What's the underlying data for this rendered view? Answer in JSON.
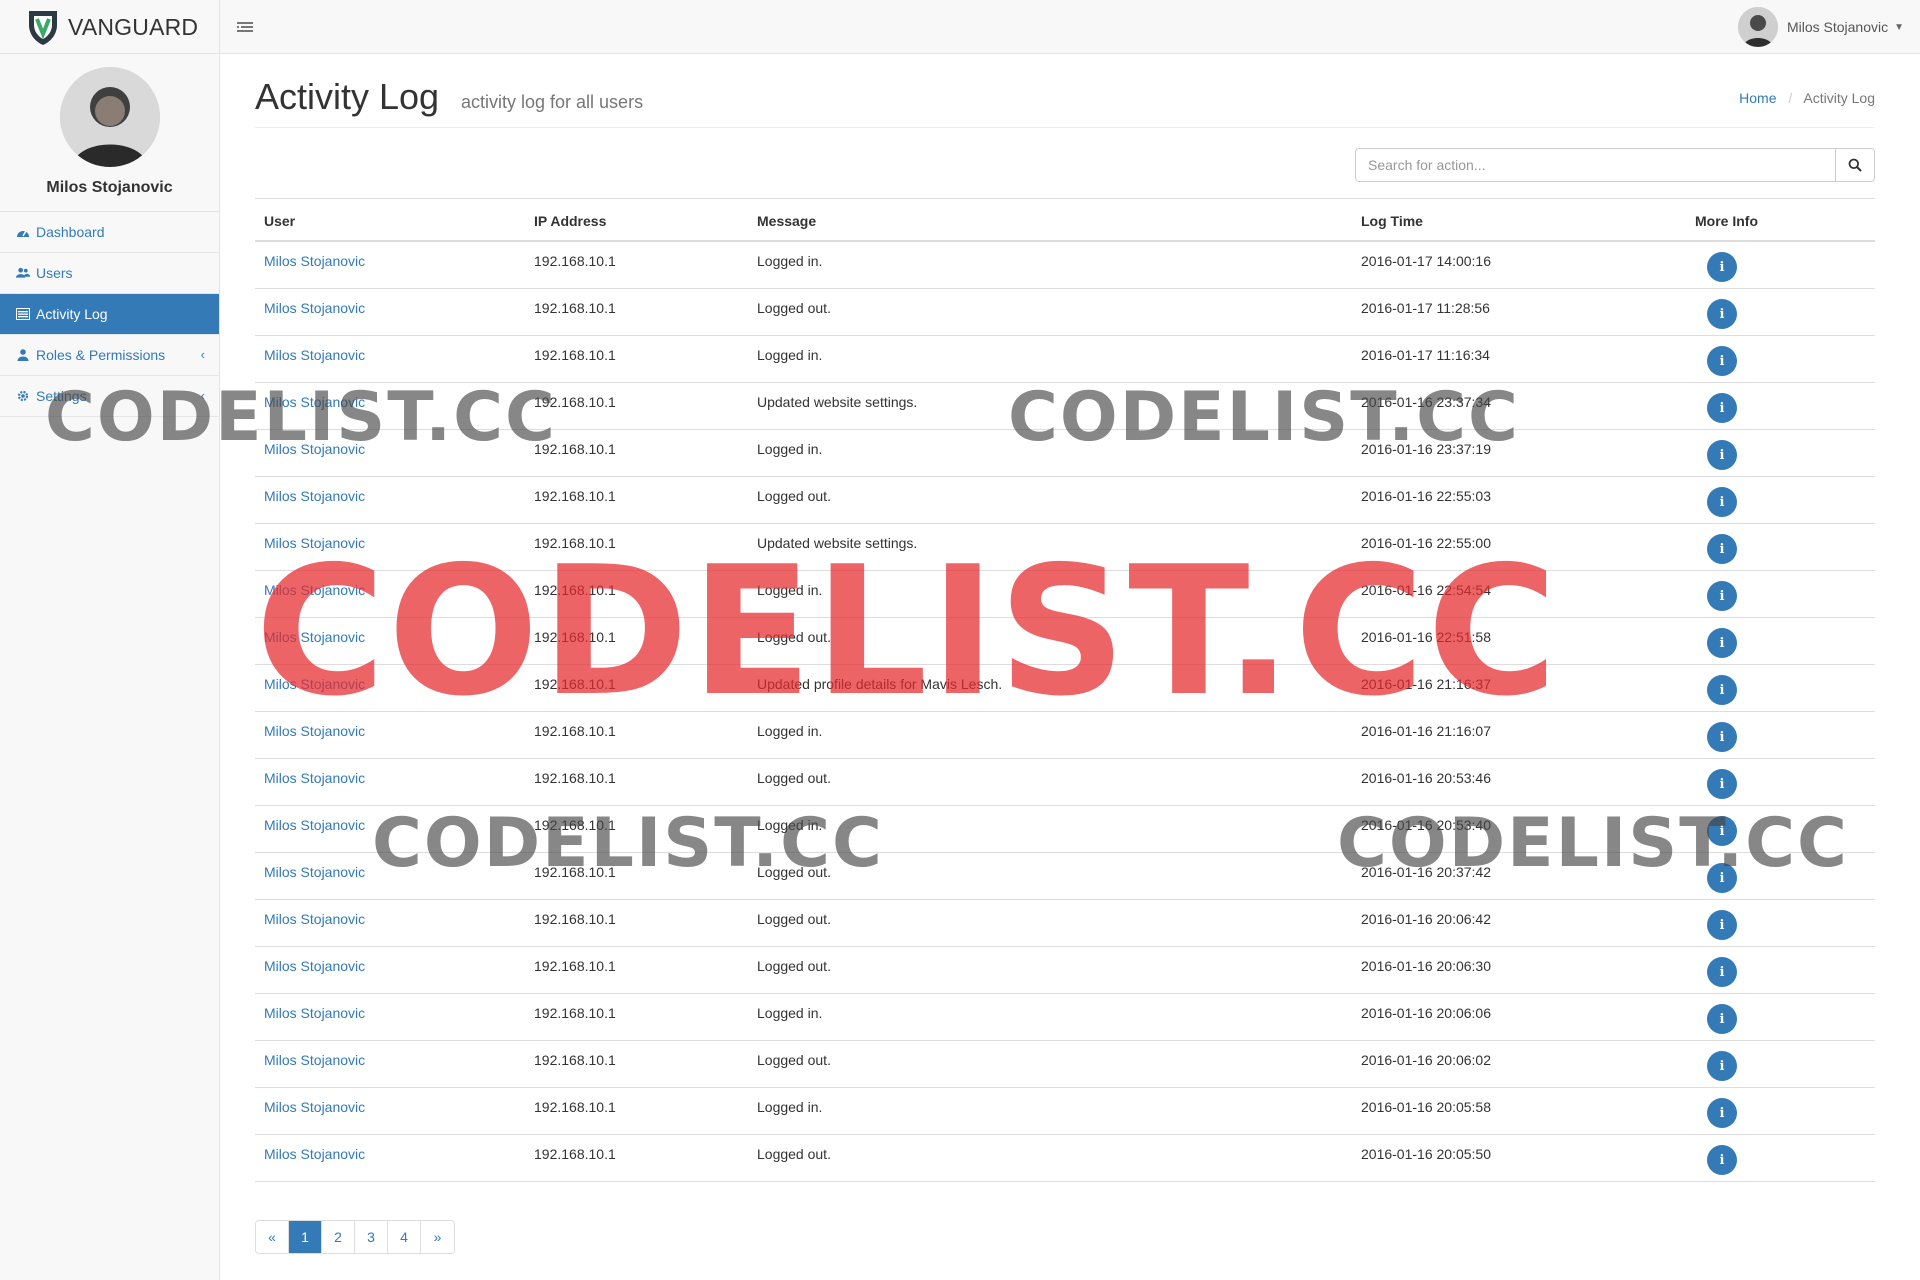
{
  "brand": {
    "name": "VANGUARD"
  },
  "topbar": {
    "user_name": "Milos Stojanovic"
  },
  "sidebar": {
    "profile_name": "Milos Stojanovic",
    "items": [
      {
        "label": "Dashboard",
        "icon": "dashboard-icon",
        "active": false
      },
      {
        "label": "Users",
        "icon": "users-icon",
        "active": false
      },
      {
        "label": "Activity Log",
        "icon": "list-icon",
        "active": true
      },
      {
        "label": "Roles & Permissions",
        "icon": "user-icon",
        "active": false,
        "expandable": true
      },
      {
        "label": "Settings",
        "icon": "gear-icon",
        "active": false,
        "expandable": true
      }
    ]
  },
  "page": {
    "title": "Activity Log",
    "subtitle": "activity log for all users",
    "breadcrumb": {
      "home": "Home",
      "current": "Activity Log"
    }
  },
  "search": {
    "placeholder": "Search for action..."
  },
  "table": {
    "columns": [
      "User",
      "IP Address",
      "Message",
      "Log Time",
      "More Info"
    ],
    "rows": [
      {
        "user": "Milos Stojanovic",
        "ip": "192.168.10.1",
        "message": "Logged in.",
        "time": "2016-01-17 14:00:16"
      },
      {
        "user": "Milos Stojanovic",
        "ip": "192.168.10.1",
        "message": "Logged out.",
        "time": "2016-01-17 11:28:56"
      },
      {
        "user": "Milos Stojanovic",
        "ip": "192.168.10.1",
        "message": "Logged in.",
        "time": "2016-01-17 11:16:34"
      },
      {
        "user": "Milos Stojanovic",
        "ip": "192.168.10.1",
        "message": "Updated website settings.",
        "time": "2016-01-16 23:37:34"
      },
      {
        "user": "Milos Stojanovic",
        "ip": "192.168.10.1",
        "message": "Logged in.",
        "time": "2016-01-16 23:37:19"
      },
      {
        "user": "Milos Stojanovic",
        "ip": "192.168.10.1",
        "message": "Logged out.",
        "time": "2016-01-16 22:55:03"
      },
      {
        "user": "Milos Stojanovic",
        "ip": "192.168.10.1",
        "message": "Updated website settings.",
        "time": "2016-01-16 22:55:00"
      },
      {
        "user": "Milos Stojanovic",
        "ip": "192.168.10.1",
        "message": "Logged in.",
        "time": "2016-01-16 22:54:54"
      },
      {
        "user": "Milos Stojanovic",
        "ip": "192.168.10.1",
        "message": "Logged out.",
        "time": "2016-01-16 22:51:58"
      },
      {
        "user": "Milos Stojanovic",
        "ip": "192.168.10.1",
        "message": "Updated profile details for Mavis Lesch.",
        "time": "2016-01-16 21:16:37"
      },
      {
        "user": "Milos Stojanovic",
        "ip": "192.168.10.1",
        "message": "Logged in.",
        "time": "2016-01-16 21:16:07"
      },
      {
        "user": "Milos Stojanovic",
        "ip": "192.168.10.1",
        "message": "Logged out.",
        "time": "2016-01-16 20:53:46"
      },
      {
        "user": "Milos Stojanovic",
        "ip": "192.168.10.1",
        "message": "Logged in.",
        "time": "2016-01-16 20:53:40"
      },
      {
        "user": "Milos Stojanovic",
        "ip": "192.168.10.1",
        "message": "Logged out.",
        "time": "2016-01-16 20:37:42"
      },
      {
        "user": "Milos Stojanovic",
        "ip": "192.168.10.1",
        "message": "Logged out.",
        "time": "2016-01-16 20:06:42"
      },
      {
        "user": "Milos Stojanovic",
        "ip": "192.168.10.1",
        "message": "Logged out.",
        "time": "2016-01-16 20:06:30"
      },
      {
        "user": "Milos Stojanovic",
        "ip": "192.168.10.1",
        "message": "Logged in.",
        "time": "2016-01-16 20:06:06"
      },
      {
        "user": "Milos Stojanovic",
        "ip": "192.168.10.1",
        "message": "Logged out.",
        "time": "2016-01-16 20:06:02"
      },
      {
        "user": "Milos Stojanovic",
        "ip": "192.168.10.1",
        "message": "Logged in.",
        "time": "2016-01-16 20:05:58"
      },
      {
        "user": "Milos Stojanovic",
        "ip": "192.168.10.1",
        "message": "Logged out.",
        "time": "2016-01-16 20:05:50"
      }
    ],
    "info_glyph": "i"
  },
  "pagination": {
    "prev": "«",
    "pages": [
      "1",
      "2",
      "3",
      "4"
    ],
    "next": "»",
    "current": "1"
  },
  "watermark": {
    "text": "CODELIST.CC"
  },
  "colors": {
    "accent": "#337ab7",
    "watermark_red": "#e6282d"
  }
}
